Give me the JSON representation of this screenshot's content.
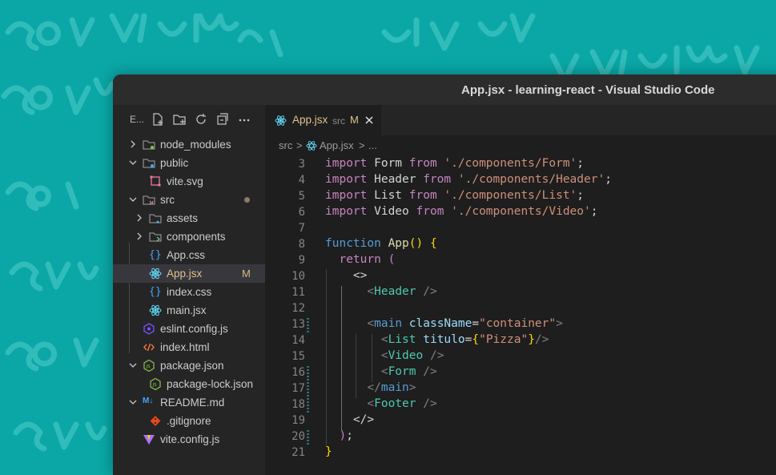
{
  "window": {
    "title": "App.jsx - learning-react - Visual Studio Code"
  },
  "colors": {
    "background": "#0aa7a6",
    "editor": "#1e1e1e",
    "sidebar": "#252526",
    "modified": "#e2c08d"
  },
  "explorer": {
    "label": "E...",
    "actions": [
      "new-file-icon",
      "new-folder-icon",
      "refresh-icon",
      "collapse-all-icon",
      "more-icon"
    ],
    "items": [
      {
        "name": "node_modules",
        "kind": "folder",
        "icon": "folder-icon"
      },
      {
        "name": "public",
        "kind": "folder-open",
        "icon": "folder-icon"
      },
      {
        "name": "vite.svg",
        "kind": "file",
        "icon": "svg-file-icon"
      },
      {
        "name": "src",
        "kind": "folder-open",
        "icon": "src-folder-icon"
      },
      {
        "name": "assets",
        "kind": "folder",
        "icon": "assets-folder-icon"
      },
      {
        "name": "components",
        "kind": "folder",
        "icon": "components-folder-icon"
      },
      {
        "name": "App.css",
        "kind": "file",
        "icon": "css-file-icon"
      },
      {
        "name": "App.jsx",
        "kind": "file",
        "icon": "react-icon",
        "badge": "M"
      },
      {
        "name": "index.css",
        "kind": "file",
        "icon": "css-file-icon"
      },
      {
        "name": "main.jsx",
        "kind": "file",
        "icon": "react-icon"
      },
      {
        "name": "eslint.config.js",
        "kind": "file",
        "icon": "eslint-icon"
      },
      {
        "name": "index.html",
        "kind": "file",
        "icon": "html-file-icon"
      },
      {
        "name": "package.json",
        "kind": "folder-file",
        "icon": "node-icon"
      },
      {
        "name": "package-lock.json",
        "kind": "file",
        "icon": "node-icon"
      },
      {
        "name": "README.md",
        "kind": "folder-file",
        "icon": "markdown-icon"
      },
      {
        "name": ".gitignore",
        "kind": "file",
        "icon": "git-icon"
      },
      {
        "name": "vite.config.js",
        "kind": "file",
        "icon": "vite-icon"
      }
    ]
  },
  "tab": {
    "name": "App.jsx",
    "dir": "src",
    "badge": "M"
  },
  "breadcrumb": {
    "folder": "src",
    "sep": ">",
    "file": "App.jsx",
    "more": "..."
  },
  "editor": {
    "line_numbers": [
      "3",
      "4",
      "5",
      "6",
      "7",
      "8",
      "9",
      "10",
      "11",
      "12",
      "13",
      "14",
      "15",
      "16",
      "17",
      "18",
      "19",
      "20",
      "21"
    ],
    "lines": [
      [
        [
          "import ",
          "k-mag"
        ],
        [
          "Form ",
          "k-text"
        ],
        [
          "from ",
          "k-mag"
        ],
        [
          "'./components/Form'",
          "k-str"
        ],
        [
          ";",
          "k-text"
        ]
      ],
      [
        [
          "import ",
          "k-mag"
        ],
        [
          "Header ",
          "k-text"
        ],
        [
          "from ",
          "k-mag"
        ],
        [
          "'./components/Header'",
          "k-str"
        ],
        [
          ";",
          "k-text"
        ]
      ],
      [
        [
          "import ",
          "k-mag"
        ],
        [
          "List ",
          "k-text"
        ],
        [
          "from ",
          "k-mag"
        ],
        [
          "'./components/List'",
          "k-str"
        ],
        [
          ";",
          "k-text"
        ]
      ],
      [
        [
          "import ",
          "k-mag"
        ],
        [
          "Video ",
          "k-text"
        ],
        [
          "from ",
          "k-mag"
        ],
        [
          "'./components/Video'",
          "k-str"
        ],
        [
          ";",
          "k-text"
        ]
      ],
      [],
      [
        [
          "function ",
          "k-blue"
        ],
        [
          "App",
          "k-fn"
        ],
        [
          "() ",
          "k-br"
        ],
        [
          "{",
          "k-br"
        ]
      ],
      [
        [
          "  ",
          "k-text"
        ],
        [
          "return ",
          "k-mag"
        ],
        [
          "(",
          "k-br2"
        ]
      ],
      [
        [
          "    ",
          "k-text"
        ],
        [
          "<>",
          "k-text"
        ]
      ],
      [
        [
          "      ",
          "k-text"
        ],
        [
          "<",
          "k-punc"
        ],
        [
          "Header",
          "k-comp"
        ],
        [
          " />",
          "k-punc"
        ]
      ],
      [],
      [
        [
          "      ",
          "k-text"
        ],
        [
          "<",
          "k-punc"
        ],
        [
          "main ",
          "k-tag"
        ],
        [
          "className",
          "k-attr"
        ],
        [
          "=",
          "k-text"
        ],
        [
          "\"container\"",
          "k-str"
        ],
        [
          ">",
          "k-punc"
        ]
      ],
      [
        [
          "        ",
          "k-text"
        ],
        [
          "<",
          "k-punc"
        ],
        [
          "List ",
          "k-comp"
        ],
        [
          "titulo",
          "k-attr"
        ],
        [
          "=",
          "k-text"
        ],
        [
          "{",
          "k-br"
        ],
        [
          "\"Pizza\"",
          "k-str"
        ],
        [
          "}",
          "k-br"
        ],
        [
          "/>",
          "k-punc"
        ]
      ],
      [
        [
          "        ",
          "k-text"
        ],
        [
          "<",
          "k-punc"
        ],
        [
          "Video",
          "k-comp"
        ],
        [
          " />",
          "k-punc"
        ]
      ],
      [
        [
          "        ",
          "k-text"
        ],
        [
          "<",
          "k-punc"
        ],
        [
          "Form",
          "k-comp"
        ],
        [
          " />",
          "k-punc"
        ]
      ],
      [
        [
          "      ",
          "k-text"
        ],
        [
          "</",
          "k-punc"
        ],
        [
          "main",
          "k-tag"
        ],
        [
          ">",
          "k-punc"
        ]
      ],
      [
        [
          "      ",
          "k-text"
        ],
        [
          "<",
          "k-punc"
        ],
        [
          "Footer",
          "k-comp"
        ],
        [
          " />",
          "k-punc"
        ]
      ],
      [
        [
          "    ",
          "k-text"
        ],
        [
          "</>",
          "k-text"
        ]
      ],
      [
        [
          "  ",
          "k-text"
        ],
        [
          ")",
          "k-br2"
        ],
        [
          ";",
          "k-text"
        ]
      ],
      [
        [
          "}",
          "k-br"
        ]
      ]
    ]
  }
}
